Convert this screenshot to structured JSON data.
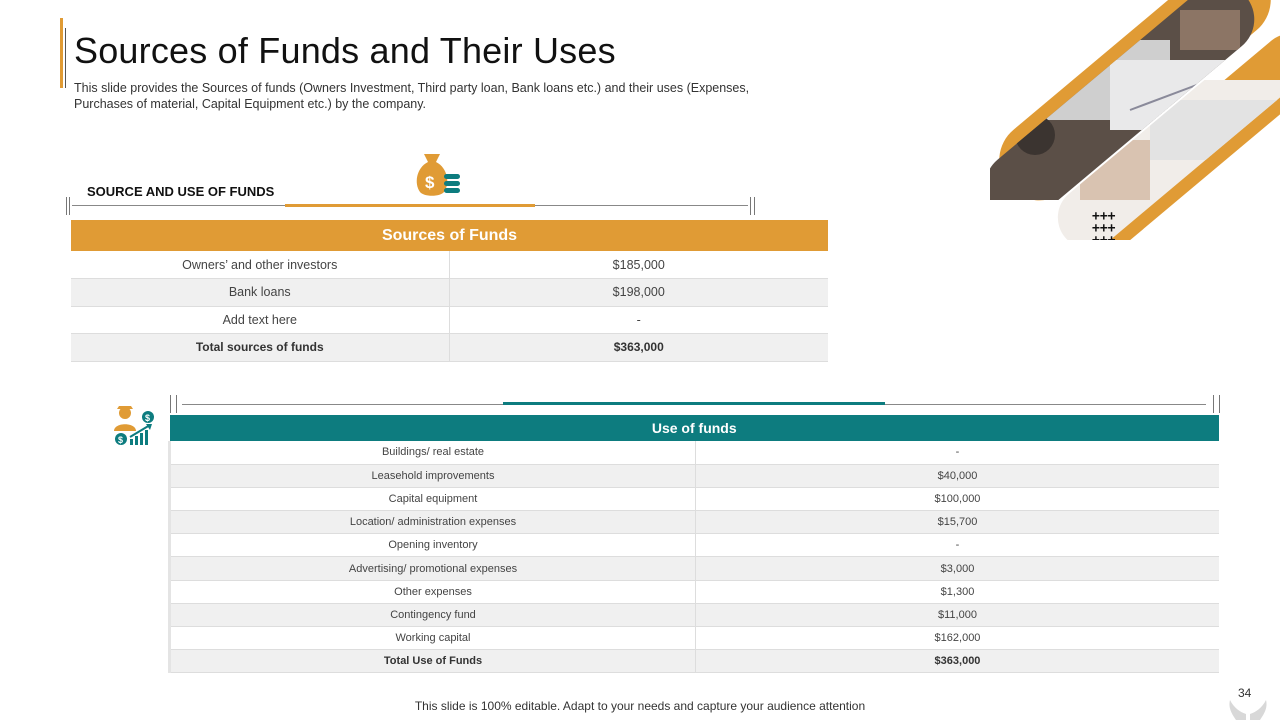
{
  "header": {
    "title": "Sources of Funds and Their Uses",
    "subtitle": "This slide provides the Sources of funds (Owners Investment, Third party loan, Bank loans etc.) and their uses (Expenses, Purchases of material, Capital Equipment etc.) by the company."
  },
  "sources": {
    "section_label": "SOURCE AND USE OF FUNDS",
    "table_title": "Sources of Funds",
    "rows": [
      {
        "label": "Owners’ and other investors",
        "value": "$185,000"
      },
      {
        "label": "Bank loans",
        "value": "$198,000"
      },
      {
        "label": "Add text here",
        "value": "-"
      }
    ],
    "total": {
      "label": "Total sources of funds",
      "value": "$363,000"
    }
  },
  "uses": {
    "table_title": "Use of funds",
    "rows": [
      {
        "label": "Buildings/ real estate",
        "value": "-"
      },
      {
        "label": "Leasehold improvements",
        "value": "$40,000"
      },
      {
        "label": "Capital equipment",
        "value": "$100,000"
      },
      {
        "label": "Location/ administration expenses",
        "value": "$15,700"
      },
      {
        "label": "Opening inventory",
        "value": "-"
      },
      {
        "label": "Advertising/ promotional expenses",
        "value": "$3,000"
      },
      {
        "label": "Other expenses",
        "value": "$1,300"
      },
      {
        "label": "Contingency fund",
        "value": "$11,000"
      },
      {
        "label": "Working capital",
        "value": "$162,000"
      }
    ],
    "total": {
      "label": "Total Use of Funds",
      "value": "$363,000"
    }
  },
  "footer": {
    "note": "This slide is 100% editable. Adapt to your needs and capture your audience attention",
    "page_number": "34"
  },
  "icons": {
    "money_bag": "money-bag-icon",
    "investor": "investor-growth-icon",
    "hands": "hands-icon",
    "plus_pattern": "plus-pattern-icon"
  },
  "colors": {
    "accent_orange": "#e09b35",
    "accent_teal": "#0d7c7f"
  }
}
